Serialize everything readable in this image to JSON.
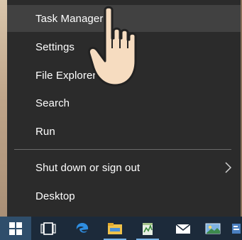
{
  "menu": {
    "items": [
      {
        "label": "Task Manager",
        "highlighted": true
      },
      {
        "label": "Settings"
      },
      {
        "label": "File Explorer"
      },
      {
        "label": "Search"
      },
      {
        "label": "Run"
      },
      {
        "label": "Shut down or sign out",
        "has_submenu": true
      },
      {
        "label": "Desktop"
      }
    ]
  },
  "taskbar": {
    "icons": [
      "windows-start-icon",
      "task-view-icon",
      "edge-browser-icon",
      "file-explorer-icon",
      "notepad-icon",
      "store-icon",
      "mail-icon",
      "photos-icon",
      "app-icon"
    ]
  },
  "colors": {
    "menu_bg": "#2b2b2b",
    "menu_hover": "#414141",
    "taskbar_bg": "#1c2a3a",
    "start_bg": "#2f4e6b"
  }
}
